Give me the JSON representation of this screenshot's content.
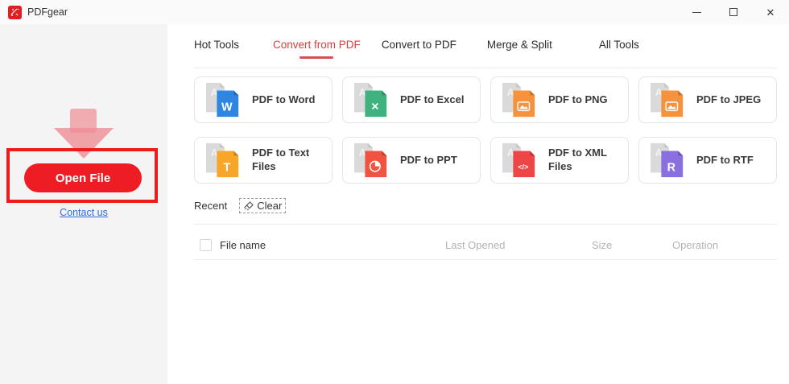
{
  "window": {
    "title": "PDFgear",
    "controls": {
      "minimize": "minimize",
      "maximize": "maximize",
      "close": "✕"
    }
  },
  "sidebar": {
    "open_file_button": "Open File",
    "contact_link": "Contact us"
  },
  "tabs": [
    {
      "label": "Hot Tools",
      "active": false
    },
    {
      "label": "Convert from PDF",
      "active": true
    },
    {
      "label": "Convert to PDF",
      "active": false
    },
    {
      "label": "Merge & Split",
      "active": false
    },
    {
      "label": "All Tools",
      "active": false
    }
  ],
  "tools": [
    {
      "label": "PDF to Word",
      "icon": "word-file-icon",
      "glyph": "W",
      "color": "#2e86e0"
    },
    {
      "label": "PDF to Excel",
      "icon": "excel-file-icon",
      "glyph": "✕",
      "color": "#3fb27f"
    },
    {
      "label": "PDF to PNG",
      "icon": "png-image-icon",
      "glyph": "",
      "color": "#f5923d"
    },
    {
      "label": "PDF to JPEG",
      "icon": "jpeg-image-icon",
      "glyph": "",
      "color": "#f5923d"
    },
    {
      "label": "PDF to Text Files",
      "icon": "text-file-icon",
      "glyph": "T",
      "color": "#f8a62a"
    },
    {
      "label": "PDF to PPT",
      "icon": "ppt-pie-icon",
      "glyph": "",
      "color": "#f05441"
    },
    {
      "label": "PDF to XML Files",
      "icon": "xml-code-icon",
      "glyph": "</>",
      "color": "#ee4547"
    },
    {
      "label": "PDF to RTF",
      "icon": "rtf-file-icon",
      "glyph": "R",
      "color": "#8a6fe0"
    }
  ],
  "recent": {
    "label": "Recent",
    "clear_label": "Clear"
  },
  "table": {
    "headers": {
      "file_name": "File name",
      "last_opened": "Last Opened",
      "size": "Size",
      "operation": "Operation"
    }
  },
  "colors": {
    "accent_red": "#ee1d24",
    "highlight_box": "#ec1c1c",
    "active_tab": "#d6413f",
    "link_blue": "#2a6fdb"
  }
}
